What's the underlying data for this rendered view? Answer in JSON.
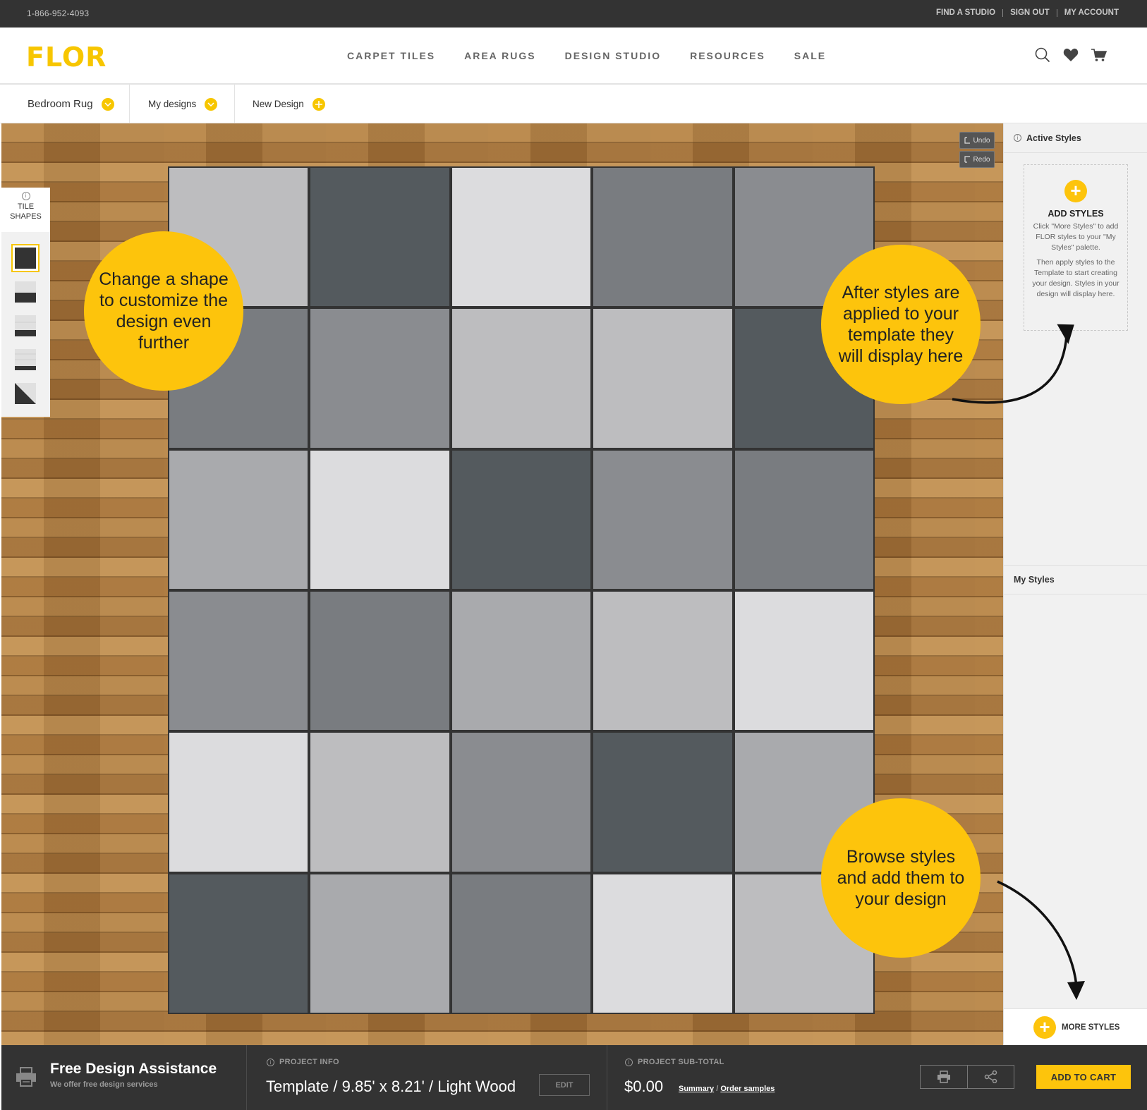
{
  "topbar": {
    "phone": "1-866-952-4093",
    "links": [
      "FIND A STUDIO",
      "SIGN OUT",
      "MY ACCOUNT"
    ]
  },
  "header": {
    "logo": "FLOR",
    "nav": [
      "CARPET TILES",
      "AREA RUGS",
      "DESIGN STUDIO",
      "RESOURCES",
      "SALE"
    ],
    "icons": [
      "search-icon",
      "heart-icon",
      "cart-icon"
    ]
  },
  "design_tabs": [
    {
      "label": "Bedroom Rug",
      "icon": "chevron-down-icon"
    },
    {
      "label": "My designs",
      "icon": "chevron-down-icon"
    },
    {
      "label": "New Design",
      "icon": "plus-icon"
    }
  ],
  "tile_shapes": {
    "label_line1": "TILE",
    "label_line2": "SHAPES",
    "info": "i",
    "shapes": [
      "square",
      "rectangle-bottom",
      "rectangle-stripe",
      "plank-stripes",
      "triangle"
    ]
  },
  "history": {
    "undo": "Undo",
    "redo": "Redo"
  },
  "rug": {
    "rows": 6,
    "cols": 5,
    "tiles": [
      [
        "#bdbdbf",
        "#545a5e",
        "#dcdcde",
        "#797c80",
        "#8a8c90"
      ],
      [
        "#797c80",
        "#8a8c90",
        "#bdbdbf",
        "#bdbdbf",
        "#545a5e"
      ],
      [
        "#a9aaad",
        "#dcdcde",
        "#545a5e",
        "#8a8c90",
        "#797c80"
      ],
      [
        "#8a8c90",
        "#797c80",
        "#a9aaad",
        "#bdbdbf",
        "#dcdcde"
      ],
      [
        "#dcdcde",
        "#bdbdbf",
        "#8a8c90",
        "#545a5e",
        "#a9aaad"
      ],
      [
        "#545a5e",
        "#a9aaad",
        "#797c80",
        "#dcdcde",
        "#bdbdbf"
      ]
    ]
  },
  "callouts": {
    "shape": "Change a shape to customize the design even further",
    "styles": "After styles are applied to your template they will display here",
    "browse": "Browse styles and add them to your design"
  },
  "right_panel": {
    "active_styles": "Active Styles",
    "add_styles_title": "ADD STYLES",
    "add_styles_text1": "Click \"More Styles\" to add FLOR styles to your \"My Styles\" palette.",
    "add_styles_text2": "Then apply styles to the Template to start creating your design. Styles in your design will display here.",
    "my_styles": "My Styles",
    "more_styles": "MORE STYLES"
  },
  "footer": {
    "assist_title": "Free Design Assistance",
    "assist_sub": "We offer free design services",
    "project_info_label": "PROJECT INFO",
    "project_info": "Template / 9.85' x 8.21' / Light Wood",
    "edit": "EDIT",
    "subtotal_label": "PROJECT SUB-TOTAL",
    "subtotal": "$0.00",
    "summary": "Summary",
    "slash": "/",
    "order_samples": "Order samples",
    "add_to_cart": "ADD TO CART"
  },
  "colors": {
    "accent": "#fdc40c",
    "dark": "#333333"
  }
}
